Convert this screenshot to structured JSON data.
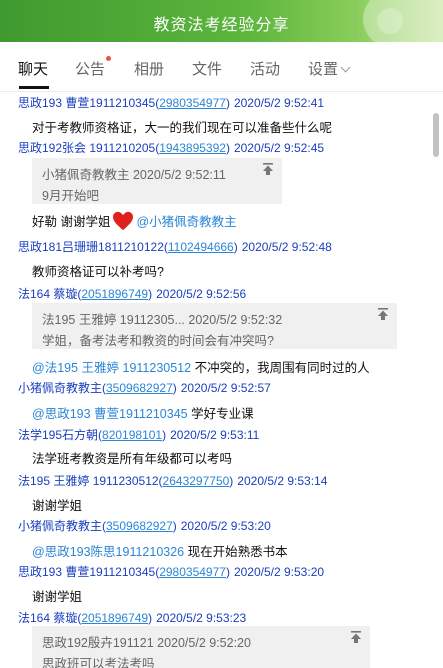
{
  "window": {
    "title": "教资法考经验分享"
  },
  "tabs": [
    {
      "label": "聊天"
    },
    {
      "label": "公告"
    },
    {
      "label": "相册"
    },
    {
      "label": "文件"
    },
    {
      "label": "活动"
    },
    {
      "label": "设置"
    }
  ],
  "messages": [
    {
      "name": "思政193 曹萱1911210345(",
      "qq": "2980354977",
      "close": ")",
      "time": "2020/5/2 9:52:41",
      "text": "对于考教师资格证，大一的我们现在可以准备些什么呢"
    },
    {
      "name": "思政192张会 1911210205(",
      "qq": "1943895392",
      "close": ")",
      "time": "2020/5/2 9:52:45",
      "quote_header": "小猪佩奇教教主  2020/5/2 9:52:11",
      "quote_text": "9月开始吧",
      "text_a": "好勒 谢谢学姐",
      "mention": "@小猪佩奇教教主"
    },
    {
      "name": "思政181吕珊珊1811210122(",
      "qq": "1102494666",
      "close": ")",
      "time": "2020/5/2 9:52:48",
      "text": "教师资格证可以补考吗?"
    },
    {
      "name": "法164 蔡璇(",
      "qq": "2051896749",
      "close": ")",
      "time": "2020/5/2 9:52:56",
      "quote_header": "法195 王雅婷 19112305...  2020/5/2 9:52:32",
      "quote_text": "学姐，备考法考和教资的时间会有冲突吗?",
      "mention": "@法195 王雅婷 1911230512",
      "text": " 不冲突的，我周围有同时过的人"
    },
    {
      "name": "小猪佩奇教教主(",
      "qq": "3509682927",
      "close": ")",
      "time": "2020/5/2 9:52:57",
      "mention": "@思政193 曹萱1911210345",
      "text": " 学好专业课"
    },
    {
      "name": "法学195石方朝(",
      "qq": "820198101",
      "close": ")",
      "time": "2020/5/2 9:53:11",
      "text": "法学班考教资是所有年级都可以考吗"
    },
    {
      "name": "法195 王雅婷 1911230512(",
      "qq": "2643297750",
      "close": ")",
      "time": "2020/5/2 9:53:14",
      "text": "谢谢学姐"
    },
    {
      "name": "小猪佩奇教教主(",
      "qq": "3509682927",
      "close": ")",
      "time": "2020/5/2 9:53:20",
      "mention": "@思政193陈思1911210326",
      "text": " 现在开始熟悉书本"
    },
    {
      "name": "思政193 曹萱1911210345(",
      "qq": "2980354977",
      "close": ")",
      "time": "2020/5/2 9:53:20",
      "text": "谢谢学姐"
    },
    {
      "name": "法164 蔡璇(",
      "qq": "2051896749",
      "close": ")",
      "time": "2020/5/2 9:53:23",
      "quote_header": "思政192殷卉191121  2020/5/2 9:52:20",
      "quote_text": "思政班可以考法考吗"
    }
  ]
}
